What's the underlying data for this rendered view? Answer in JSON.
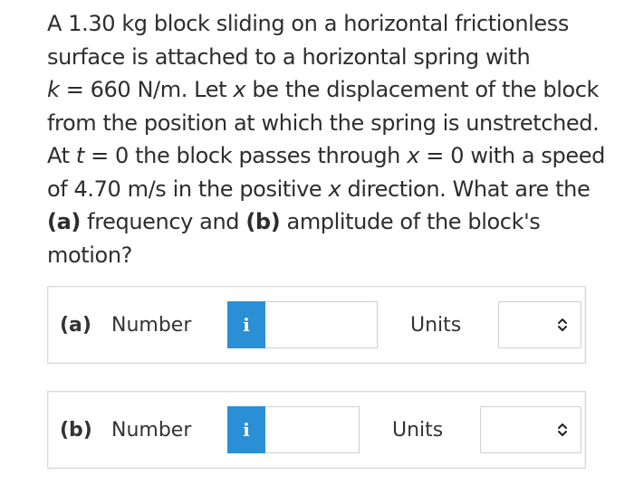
{
  "problem": {
    "line1": "A 1.30 kg block sliding on a horizontal frictionless",
    "line2": "surface is attached to a horizontal spring with",
    "line3_k": "k",
    "line3_rest": " = 660 N/m. Let ",
    "line3_x": "x",
    "line3_end": " be the displacement of the block",
    "line4": "from the position at which the spring is unstretched.",
    "line5_a": "At ",
    "line5_t": "t",
    "line5_b": " = 0 the block passes through ",
    "line5_x": "x",
    "line5_c": " = 0 with a speed",
    "line6_a": "of 4.70 m/s in the positive ",
    "line6_x": "x",
    "line6_b": " direction. What are the",
    "line7_a_bold": "(a)",
    "line7_mid": " frequency and ",
    "line7_b_bold": "(b)",
    "line7_end": " amplitude of the block's",
    "line8": "motion?"
  },
  "parts": [
    {
      "label": "(a)",
      "number_label": "Number",
      "info_label": "i",
      "number_value": "",
      "units_label": "Units",
      "units_value": ""
    },
    {
      "label": "(b)",
      "number_label": "Number",
      "info_label": "i",
      "number_value": "",
      "units_label": "Units",
      "units_value": ""
    }
  ],
  "colors": {
    "info_button": "#2a8fd4",
    "text": "#333333",
    "border": "#d9d9d9"
  },
  "icons": {
    "info": "info-icon",
    "select_arrows": "chevron-up-down-icon"
  }
}
